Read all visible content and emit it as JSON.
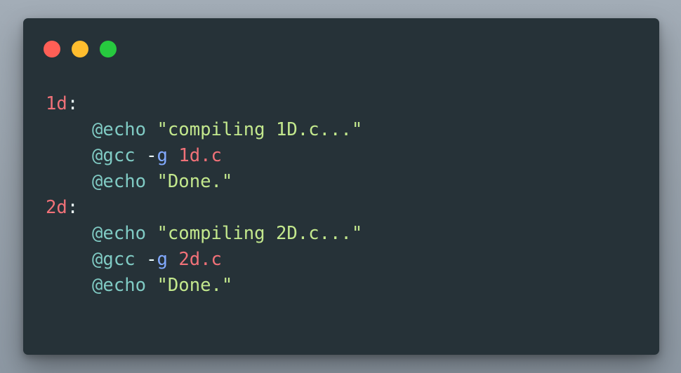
{
  "window": {
    "buttons": [
      {
        "name": "close",
        "color": "#ff5f56"
      },
      {
        "name": "minimize",
        "color": "#ffbd2e"
      },
      {
        "name": "maximize",
        "color": "#27c93f"
      }
    ]
  },
  "code": {
    "language": "makefile",
    "lines": [
      {
        "target": "1d",
        "colon": ":"
      },
      {
        "cmd": "@echo",
        "string": "\"compiling 1D.c...\""
      },
      {
        "cmd": "@gcc",
        "dash": "-",
        "flag": "g",
        "file": "1d.c"
      },
      {
        "cmd": "@echo",
        "string": "\"Done.\""
      },
      {
        "target": "2d",
        "colon": ":"
      },
      {
        "cmd": "@echo",
        "string": "\"compiling 2D.c...\""
      },
      {
        "cmd": "@gcc",
        "dash": "-",
        "flag": "g",
        "file": "2d.c"
      },
      {
        "cmd": "@echo",
        "string": "\"Done.\""
      }
    ]
  },
  "colors": {
    "background": "#263238",
    "target": "#f07178",
    "command": "#80cbc4",
    "string": "#c3e88d",
    "flag": "#82aaff",
    "text": "#eeffff"
  }
}
